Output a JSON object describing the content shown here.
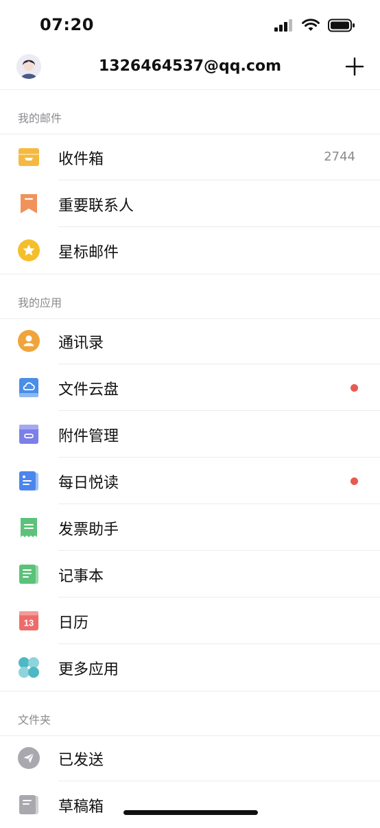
{
  "status_bar": {
    "time": "07:20"
  },
  "header": {
    "account": "1326464537@qq.com"
  },
  "sections": {
    "mail": {
      "title": "我的邮件",
      "items": [
        {
          "label": "收件箱",
          "icon": "inbox-icon",
          "count": "2744"
        },
        {
          "label": "重要联系人",
          "icon": "bookmark-icon"
        },
        {
          "label": "星标邮件",
          "icon": "star-icon"
        }
      ]
    },
    "apps": {
      "title": "我的应用",
      "items": [
        {
          "label": "通讯录",
          "icon": "contacts-icon"
        },
        {
          "label": "文件云盘",
          "icon": "cloud-drive-icon",
          "badge": "red-dot"
        },
        {
          "label": "附件管理",
          "icon": "attachment-icon"
        },
        {
          "label": "每日悦读",
          "icon": "reading-icon",
          "badge": "red-dot"
        },
        {
          "label": "发票助手",
          "icon": "invoice-icon"
        },
        {
          "label": "记事本",
          "icon": "notepad-icon"
        },
        {
          "label": "日历",
          "icon": "calendar-icon",
          "icon_text": "13"
        },
        {
          "label": "更多应用",
          "icon": "more-apps-icon"
        }
      ]
    },
    "folders": {
      "title": "文件夹",
      "items": [
        {
          "label": "已发送",
          "icon": "sent-icon"
        },
        {
          "label": "草稿箱",
          "icon": "drafts-icon"
        }
      ]
    }
  },
  "colors": {
    "inbox": "#f5b942",
    "bookmark": "#f0925a",
    "star": "#f5bf2b",
    "contacts": "#f0a43c",
    "cloud": "#4a8ee6",
    "attachment": "#7b7fe8",
    "reading": "#4a86ee",
    "invoice": "#5cc27a",
    "notepad": "#5cc27a",
    "calendar": "#ee6b6b",
    "more_apps": "#4fb8c4",
    "sent": "#a8a8ae",
    "drafts": "#a8a8ae",
    "badge": "#e85a4f"
  }
}
